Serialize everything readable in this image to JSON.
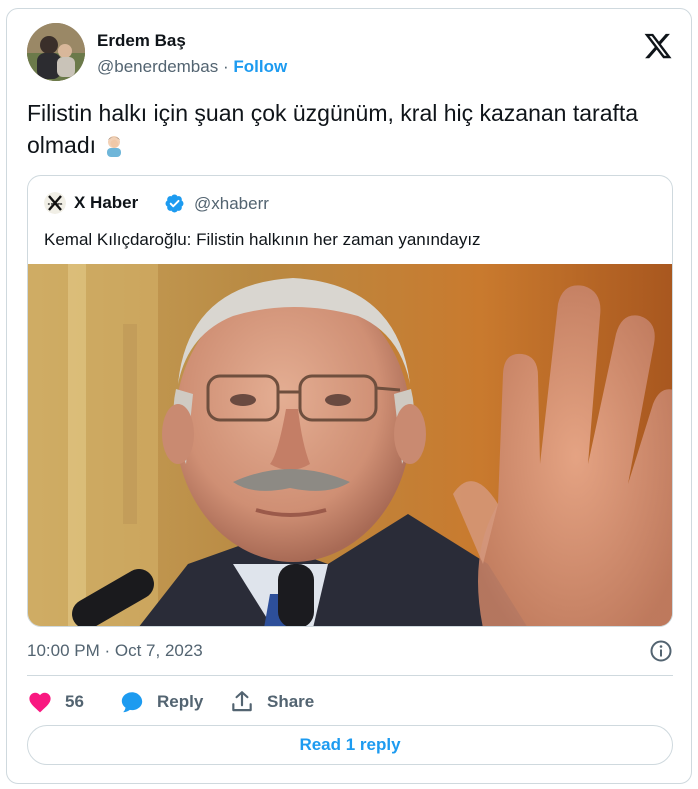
{
  "author": {
    "name": "Erdem Baş",
    "handle": "@benerdembas",
    "separator": "·",
    "follow_label": "Follow"
  },
  "tweet": {
    "text": "Filistin halkı için şuan çok üzgünüm, kral hiç kazanan tarafta olmadı",
    "emoji": "man-facepalming-emoji"
  },
  "quoted": {
    "name": "X Haber",
    "handle": "@xhaberr",
    "verified": true,
    "avatar_label": "X HABER",
    "text": "Kemal Kılıçdaroğlu: Filistin halkının her zaman yanındayız"
  },
  "meta": {
    "timestamp": "10:00 PM · Oct 7, 2023"
  },
  "actions": {
    "like_count": "56",
    "reply_label": "Reply",
    "share_label": "Share"
  },
  "footer": {
    "read_replies_label": "Read 1 reply"
  },
  "colors": {
    "accent": "#1d9bf0",
    "like": "#f91880",
    "text": "#0f1419",
    "muted": "#536471",
    "border": "#cfd9de"
  },
  "icons": [
    "x-logo-icon",
    "verified-badge-icon",
    "info-icon",
    "heart-icon",
    "reply-bubble-icon",
    "share-icon"
  ]
}
